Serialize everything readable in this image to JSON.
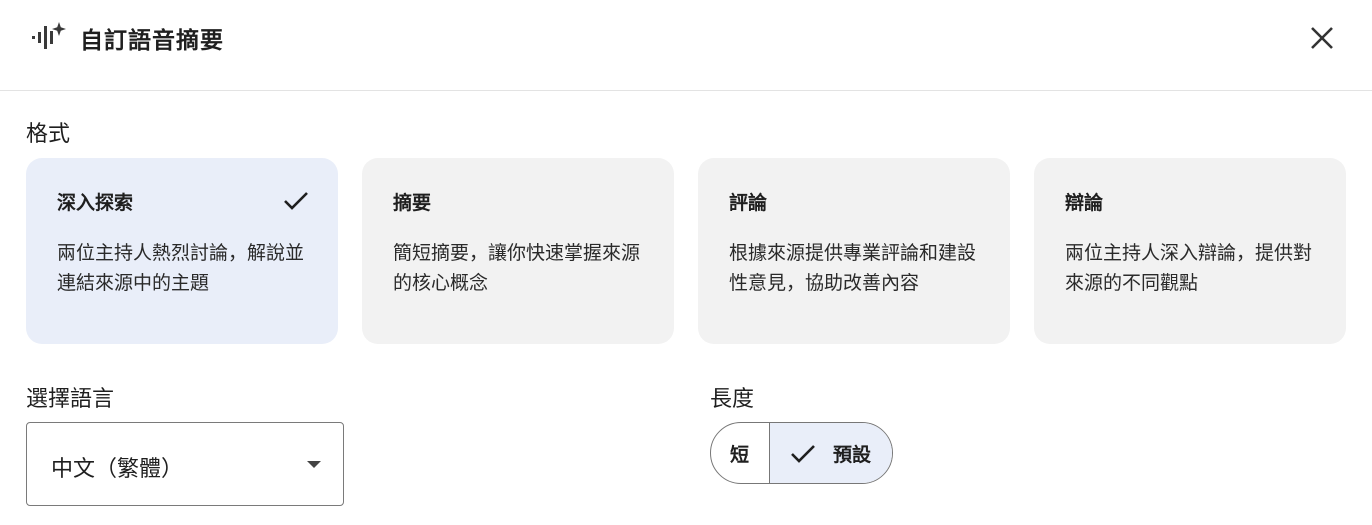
{
  "header": {
    "title": "自訂語音摘要",
    "icon": "audio-sparkle-icon",
    "close_icon": "close-icon"
  },
  "format": {
    "label": "格式",
    "cards": [
      {
        "title": "深入探索",
        "desc": "兩位主持人熱烈討論，解說並連結來源中的主題",
        "selected": true
      },
      {
        "title": "摘要",
        "desc": "簡短摘要，讓你快速掌握來源的核心概念",
        "selected": false
      },
      {
        "title": "評論",
        "desc": "根據來源提供專業評論和建設性意見，協助改善內容",
        "selected": false
      },
      {
        "title": "辯論",
        "desc": "兩位主持人深入辯論，提供對來源的不同觀點",
        "selected": false
      }
    ]
  },
  "language": {
    "label": "選擇語言",
    "value": "中文（繁體）"
  },
  "length": {
    "label": "長度",
    "options": [
      {
        "label": "短",
        "selected": false
      },
      {
        "label": "預設",
        "selected": true
      }
    ]
  },
  "colors": {
    "selected_bg": "#e9eef9",
    "card_bg": "#f2f2f2",
    "text": "#1f1f1f"
  }
}
